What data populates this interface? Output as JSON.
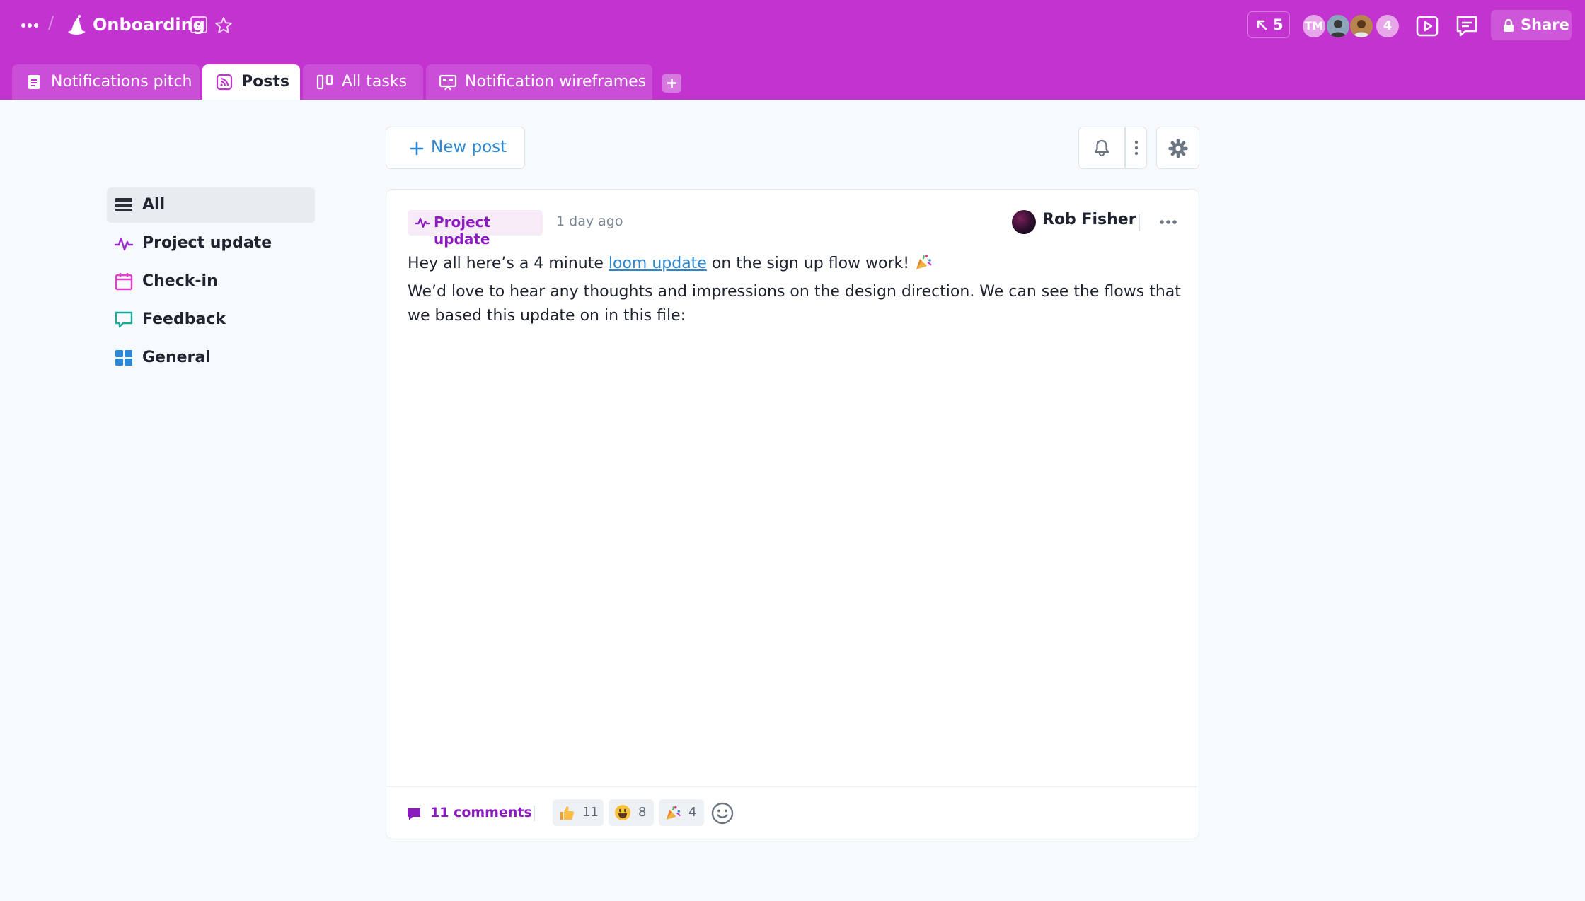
{
  "colors": {
    "brand": "#c233d0",
    "accent_purple": "#8c1bbf",
    "link_blue": "#2d86d0"
  },
  "header": {
    "workspace_title": "Onboarding",
    "cursor_count": "5",
    "avatars": {
      "initials": "TM",
      "extra_count": "4"
    },
    "share_label": "Share"
  },
  "tabs": [
    {
      "label": "Notifications pitch",
      "icon": "document-icon",
      "active": false
    },
    {
      "label": "Posts",
      "icon": "rss-icon",
      "active": true
    },
    {
      "label": "All tasks",
      "icon": "board-icon",
      "active": false
    },
    {
      "label": "Notification wireframes",
      "icon": "whiteboard-icon",
      "active": false
    }
  ],
  "sidebar": {
    "items": [
      {
        "label": "All",
        "icon": "list-icon",
        "active": true
      },
      {
        "label": "Project update",
        "icon": "pulse-icon",
        "active": false
      },
      {
        "label": "Check-in",
        "icon": "calendar-icon",
        "active": false
      },
      {
        "label": "Feedback",
        "icon": "comment-icon",
        "active": false
      },
      {
        "label": "General",
        "icon": "grid-icon",
        "active": false
      }
    ]
  },
  "toolbar": {
    "new_post_label": "New post"
  },
  "post": {
    "category": "Project update",
    "time": "1 day ago",
    "author": "Rob Fisher",
    "body": {
      "line1_before": "Hey all here’s a 4 minute ",
      "line1_link": "loom update",
      "line1_after": " on the sign up flow work! ",
      "paragraph2": "We’d love to hear any thoughts and impressions on the design direction. We can see the flows that we based this update on in this file:"
    },
    "comments_label": "11 comments",
    "reactions": [
      {
        "emoji": "thumbs-up",
        "count": "11"
      },
      {
        "emoji": "smiley",
        "count": "8"
      },
      {
        "emoji": "party-popper",
        "count": "4"
      }
    ]
  }
}
